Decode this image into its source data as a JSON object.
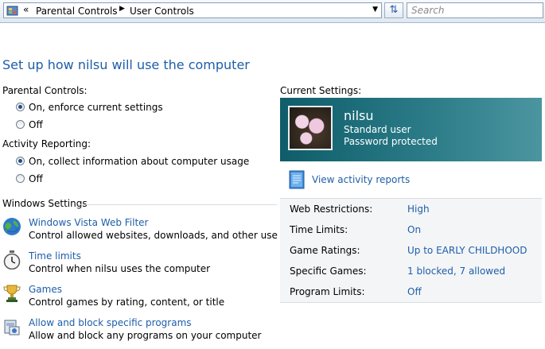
{
  "address_bar": {
    "icon": "control-panel-icon",
    "overflow_glyph": "«",
    "crumbs": [
      "Parental Controls",
      "User Controls"
    ]
  },
  "search": {
    "placeholder": "Search"
  },
  "title": "Set up how nilsu will use the computer",
  "parental_controls": {
    "label": "Parental Controls:",
    "options": [
      "On, enforce current settings",
      "Off"
    ],
    "selected": "On, enforce current settings"
  },
  "activity_reporting": {
    "label": "Activity Reporting:",
    "options": [
      "On, collect information about computer usage",
      "Off"
    ],
    "selected": "On, collect information about computer usage"
  },
  "windows_settings": {
    "heading": "Windows Settings",
    "items": [
      {
        "title": "Windows Vista Web Filter",
        "description": "Control allowed websites, downloads, and other use",
        "icon": "globe-icon"
      },
      {
        "title": "Time limits",
        "description": "Control when nilsu uses the computer",
        "icon": "clock-icon"
      },
      {
        "title": "Games",
        "description": "Control games by rating, content, or title",
        "icon": "trophy-icon"
      },
      {
        "title": "Allow and block specific programs",
        "description": "Allow and block any programs on your computer",
        "icon": "programs-icon"
      }
    ]
  },
  "current_settings": {
    "label": "Current Settings:",
    "user": {
      "name": "nilsu",
      "type": "Standard user",
      "password": "Password protected"
    },
    "activity_link": "View activity reports",
    "rows": [
      {
        "key": "Web Restrictions:",
        "value": "High"
      },
      {
        "key": "Time Limits:",
        "value": "On"
      },
      {
        "key": "Game Ratings:",
        "value": "Up to EARLY CHILDHOOD"
      },
      {
        "key": "Specific Games:",
        "value": "1 blocked, 7 allowed"
      },
      {
        "key": "Program Limits:",
        "value": "Off"
      }
    ]
  },
  "colors": {
    "link": "#1d5ea9",
    "card": "#2a7b87"
  }
}
